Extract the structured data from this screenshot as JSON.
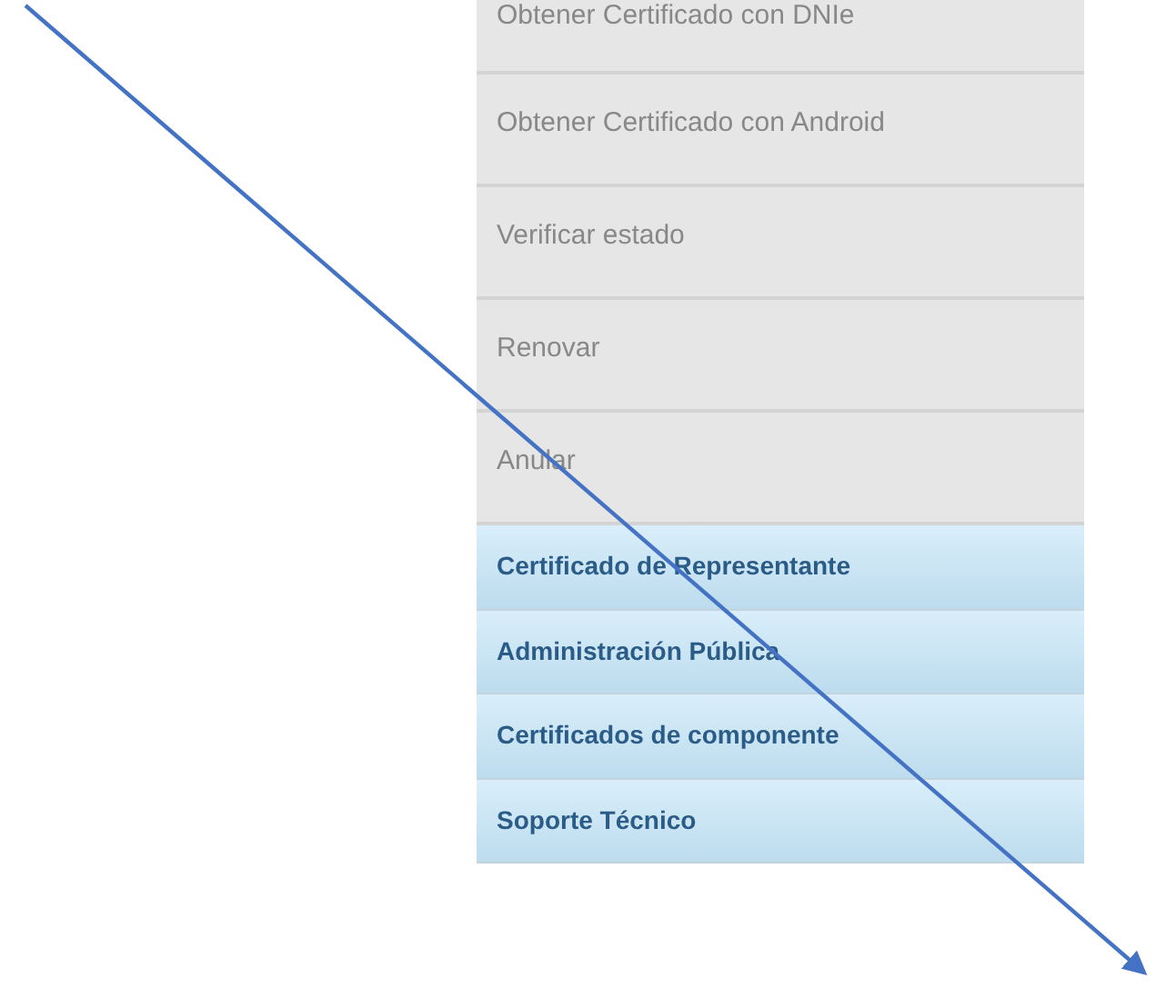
{
  "menu": {
    "items": [
      {
        "label": "Obtener Certificado con DNIe",
        "kind": "sub"
      },
      {
        "label": "Obtener Certificado con Android",
        "kind": "sub"
      },
      {
        "label": "Verificar estado",
        "kind": "sub"
      },
      {
        "label": "Renovar",
        "kind": "sub"
      },
      {
        "label": "Anular",
        "kind": "sub"
      },
      {
        "label": "Certificado de Representante",
        "kind": "section"
      },
      {
        "label": "Administración Pública",
        "kind": "section"
      },
      {
        "label": "Certificados de componente",
        "kind": "section"
      },
      {
        "label": "Soporte Técnico",
        "kind": "section"
      }
    ]
  }
}
